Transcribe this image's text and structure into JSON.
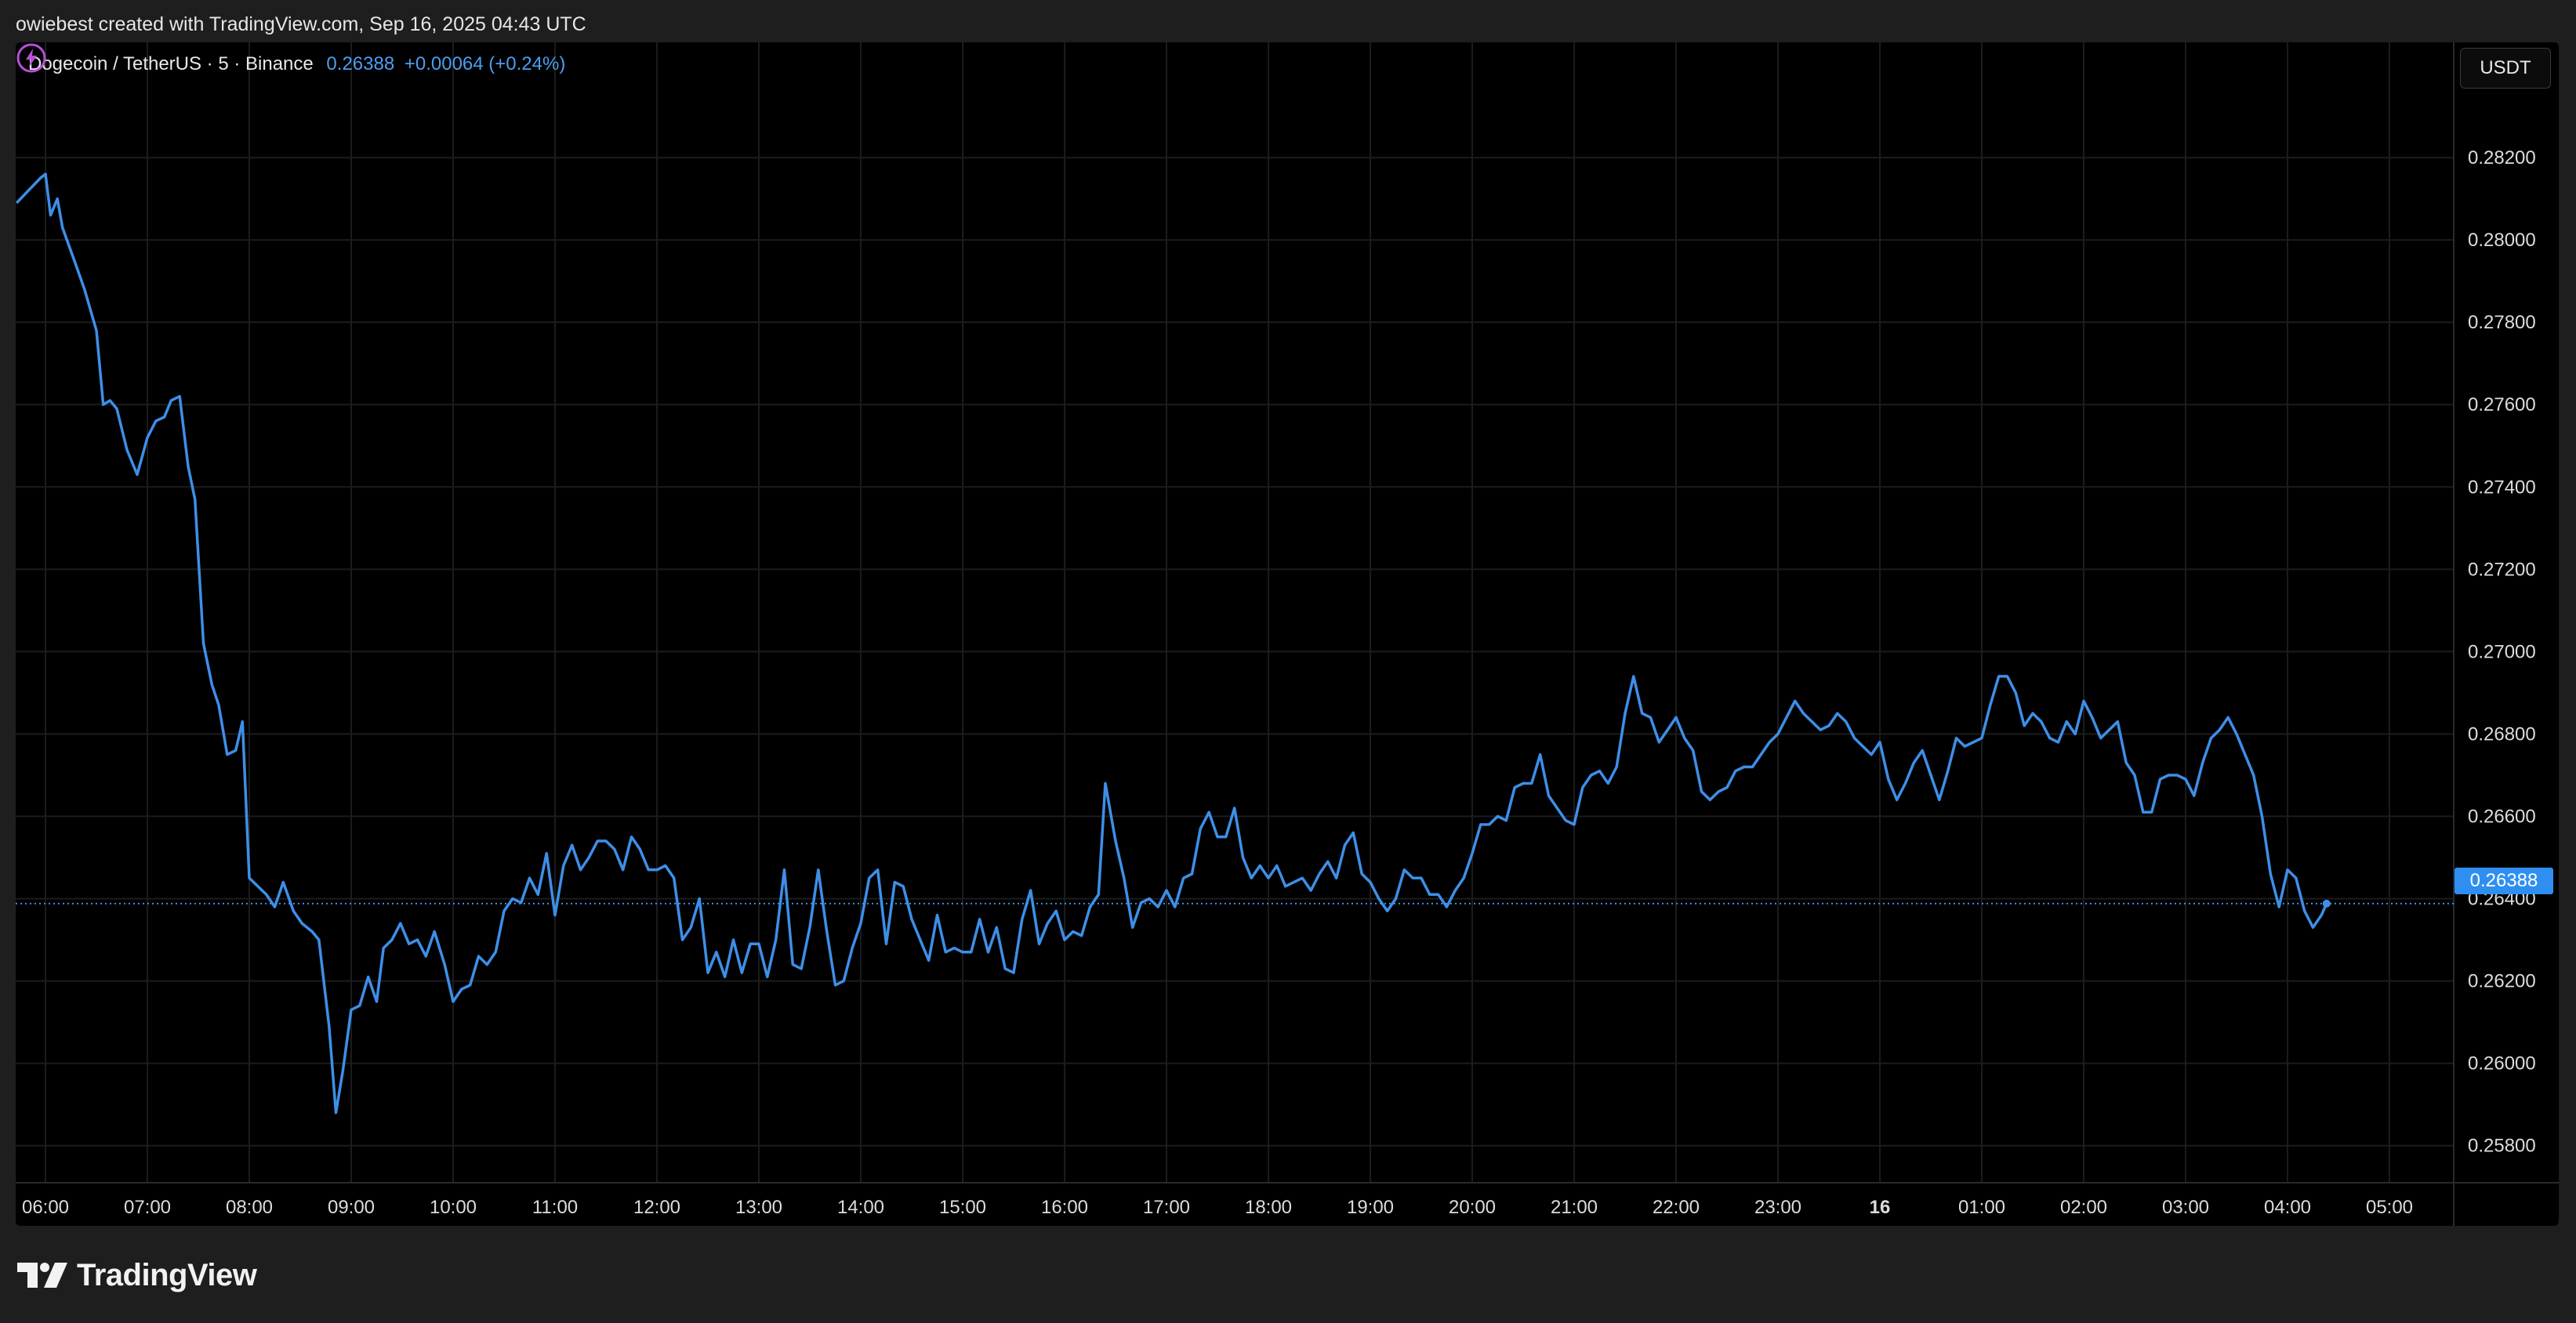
{
  "header": {
    "attribution": "owiebest created with TradingView.com, Sep 16, 2025 04:43 UTC"
  },
  "legend": {
    "symbol": "Dogecoin / TetherUS · 5 · Binance",
    "price": "0.26388",
    "change": "+0.00064 (+0.24%)"
  },
  "currency_unit": "USDT",
  "current_price_label": "0.26388",
  "footer": {
    "brand": "TradingView"
  },
  "colors": {
    "line": "#3d8fe8",
    "background": "#000000",
    "price_label": "#2f8ff0",
    "grid": "#1c1c1c",
    "bolt": "#b84fd8"
  },
  "icons": {
    "logo": "tradingview-logo-icon",
    "realtime": "lightning-bolt-icon"
  },
  "chart_data": {
    "type": "line",
    "title": "",
    "xlabel": "",
    "ylabel": "",
    "ylim": [
      0.2571,
      0.2848
    ],
    "grid": true,
    "x_ticks": [
      "06:00",
      "07:00",
      "08:00",
      "09:00",
      "10:00",
      "11:00",
      "12:00",
      "13:00",
      "14:00",
      "15:00",
      "16:00",
      "17:00",
      "18:00",
      "19:00",
      "20:00",
      "21:00",
      "22:00",
      "23:00",
      "16",
      "01:00",
      "02:00",
      "03:00",
      "04:00",
      "05:00"
    ],
    "x_tick_bold": "16",
    "y_ticks": [
      "0.28200",
      "0.28000",
      "0.27800",
      "0.27600",
      "0.27400",
      "0.27200",
      "0.27000",
      "0.26800",
      "0.26600",
      "0.26400",
      "0.26200",
      "0.26000",
      "0.25800"
    ],
    "last_price": 0.26388,
    "series": [
      {
        "points": [
          [
            "05:43",
            0.2809
          ],
          [
            "05:50",
            0.2812
          ],
          [
            "05:57",
            0.2815
          ],
          [
            "06:00",
            0.2816
          ],
          [
            "06:03",
            0.2806
          ],
          [
            "06:07",
            0.281
          ],
          [
            "06:10",
            0.2803
          ],
          [
            "06:17",
            0.2795
          ],
          [
            "06:23",
            0.2788
          ],
          [
            "06:30",
            0.2778
          ],
          [
            "06:34",
            0.276
          ],
          [
            "06:38",
            0.2761
          ],
          [
            "06:42",
            0.2759
          ],
          [
            "06:48",
            0.2749
          ],
          [
            "06:54",
            0.2743
          ],
          [
            "07:00",
            0.2752
          ],
          [
            "07:05",
            0.2756
          ],
          [
            "07:10",
            0.2757
          ],
          [
            "07:14",
            0.2761
          ],
          [
            "07:19",
            0.2762
          ],
          [
            "07:24",
            0.2745
          ],
          [
            "07:28",
            0.2737
          ],
          [
            "07:33",
            0.2702
          ],
          [
            "07:38",
            0.2692
          ],
          [
            "07:42",
            0.2687
          ],
          [
            "07:47",
            0.2675
          ],
          [
            "07:52",
            0.2676
          ],
          [
            "07:56",
            0.2683
          ],
          [
            "08:00",
            0.2645
          ],
          [
            "08:05",
            0.2643
          ],
          [
            "08:10",
            0.2641
          ],
          [
            "08:15",
            0.2638
          ],
          [
            "08:20",
            0.2644
          ],
          [
            "08:26",
            0.2637
          ],
          [
            "08:31",
            0.2634
          ],
          [
            "08:37",
            0.2632
          ],
          [
            "08:41",
            0.263
          ],
          [
            "08:47",
            0.2609
          ],
          [
            "08:51",
            0.2588
          ],
          [
            "08:55",
            0.2598
          ],
          [
            "09:00",
            0.2613
          ],
          [
            "09:05",
            0.2614
          ],
          [
            "09:10",
            0.2621
          ],
          [
            "09:15",
            0.2615
          ],
          [
            "09:19",
            0.2628
          ],
          [
            "09:24",
            0.263
          ],
          [
            "09:29",
            0.2634
          ],
          [
            "09:34",
            0.2629
          ],
          [
            "09:39",
            0.263
          ],
          [
            "09:44",
            0.2626
          ],
          [
            "09:49",
            0.2632
          ],
          [
            "09:55",
            0.2624
          ],
          [
            "10:00",
            0.2615
          ],
          [
            "10:05",
            0.2618
          ],
          [
            "10:10",
            0.2619
          ],
          [
            "10:15",
            0.2626
          ],
          [
            "10:20",
            0.2624
          ],
          [
            "10:25",
            0.2627
          ],
          [
            "10:30",
            0.2637
          ],
          [
            "10:35",
            0.264
          ],
          [
            "10:40",
            0.2639
          ],
          [
            "10:45",
            0.2645
          ],
          [
            "10:50",
            0.2641
          ],
          [
            "10:55",
            0.2651
          ],
          [
            "11:00",
            0.2636
          ],
          [
            "11:05",
            0.2648
          ],
          [
            "11:10",
            0.2653
          ],
          [
            "11:15",
            0.2647
          ],
          [
            "11:20",
            0.265
          ],
          [
            "11:25",
            0.2654
          ],
          [
            "11:30",
            0.2654
          ],
          [
            "11:35",
            0.2652
          ],
          [
            "11:40",
            0.2647
          ],
          [
            "11:45",
            0.2655
          ],
          [
            "11:50",
            0.2652
          ],
          [
            "11:55",
            0.2647
          ],
          [
            "12:00",
            0.2647
          ],
          [
            "12:05",
            0.2648
          ],
          [
            "12:10",
            0.2645
          ],
          [
            "12:15",
            0.263
          ],
          [
            "12:20",
            0.2633
          ],
          [
            "12:25",
            0.264
          ],
          [
            "12:30",
            0.2622
          ],
          [
            "12:35",
            0.2627
          ],
          [
            "12:40",
            0.2621
          ],
          [
            "12:45",
            0.263
          ],
          [
            "12:50",
            0.2622
          ],
          [
            "12:55",
            0.2629
          ],
          [
            "13:00",
            0.2629
          ],
          [
            "13:05",
            0.2621
          ],
          [
            "13:10",
            0.263
          ],
          [
            "13:15",
            0.2647
          ],
          [
            "13:20",
            0.2624
          ],
          [
            "13:25",
            0.2623
          ],
          [
            "13:30",
            0.2633
          ],
          [
            "13:35",
            0.2647
          ],
          [
            "13:40",
            0.2632
          ],
          [
            "13:45",
            0.2619
          ],
          [
            "13:50",
            0.262
          ],
          [
            "13:55",
            0.2628
          ],
          [
            "14:00",
            0.2634
          ],
          [
            "14:05",
            0.2645
          ],
          [
            "14:10",
            0.2647
          ],
          [
            "14:15",
            0.2629
          ],
          [
            "14:20",
            0.2644
          ],
          [
            "14:25",
            0.2643
          ],
          [
            "14:30",
            0.2635
          ],
          [
            "14:35",
            0.263
          ],
          [
            "14:40",
            0.2625
          ],
          [
            "14:45",
            0.2636
          ],
          [
            "14:50",
            0.2627
          ],
          [
            "14:55",
            0.2628
          ],
          [
            "15:00",
            0.2627
          ],
          [
            "15:05",
            0.2627
          ],
          [
            "15:10",
            0.2635
          ],
          [
            "15:15",
            0.2627
          ],
          [
            "15:20",
            0.2633
          ],
          [
            "15:25",
            0.2623
          ],
          [
            "15:30",
            0.2622
          ],
          [
            "15:35",
            0.2635
          ],
          [
            "15:40",
            0.2642
          ],
          [
            "15:45",
            0.2629
          ],
          [
            "15:50",
            0.2634
          ],
          [
            "15:55",
            0.2637
          ],
          [
            "16:00",
            0.263
          ],
          [
            "16:05",
            0.2632
          ],
          [
            "16:10",
            0.2631
          ],
          [
            "16:15",
            0.2638
          ],
          [
            "16:20",
            0.2641
          ],
          [
            "16:24",
            0.2668
          ],
          [
            "16:30",
            0.2654
          ],
          [
            "16:35",
            0.2645
          ],
          [
            "16:40",
            0.2633
          ],
          [
            "16:45",
            0.2639
          ],
          [
            "16:50",
            0.264
          ],
          [
            "16:55",
            0.2638
          ],
          [
            "17:00",
            0.2642
          ],
          [
            "17:05",
            0.2638
          ],
          [
            "17:10",
            0.2645
          ],
          [
            "17:15",
            0.2646
          ],
          [
            "17:20",
            0.2657
          ],
          [
            "17:25",
            0.2661
          ],
          [
            "17:30",
            0.2655
          ],
          [
            "17:35",
            0.2655
          ],
          [
            "17:40",
            0.2662
          ],
          [
            "17:45",
            0.265
          ],
          [
            "17:50",
            0.2645
          ],
          [
            "17:55",
            0.2648
          ],
          [
            "18:00",
            0.2645
          ],
          [
            "18:05",
            0.2648
          ],
          [
            "18:10",
            0.2643
          ],
          [
            "18:15",
            0.2644
          ],
          [
            "18:20",
            0.2645
          ],
          [
            "18:25",
            0.2642
          ],
          [
            "18:30",
            0.2646
          ],
          [
            "18:35",
            0.2649
          ],
          [
            "18:40",
            0.2645
          ],
          [
            "18:45",
            0.2653
          ],
          [
            "18:50",
            0.2656
          ],
          [
            "18:55",
            0.2646
          ],
          [
            "19:00",
            0.2644
          ],
          [
            "19:05",
            0.264
          ],
          [
            "19:10",
            0.2637
          ],
          [
            "19:15",
            0.264
          ],
          [
            "19:20",
            0.2647
          ],
          [
            "19:25",
            0.2645
          ],
          [
            "19:30",
            0.2645
          ],
          [
            "19:35",
            0.2641
          ],
          [
            "19:40",
            0.2641
          ],
          [
            "19:45",
            0.2638
          ],
          [
            "19:50",
            0.2642
          ],
          [
            "19:55",
            0.2645
          ],
          [
            "20:00",
            0.2651
          ],
          [
            "20:05",
            0.2658
          ],
          [
            "20:10",
            0.2658
          ],
          [
            "20:15",
            0.266
          ],
          [
            "20:20",
            0.2659
          ],
          [
            "20:25",
            0.2667
          ],
          [
            "20:30",
            0.2668
          ],
          [
            "20:35",
            0.2668
          ],
          [
            "20:40",
            0.2675
          ],
          [
            "20:45",
            0.2665
          ],
          [
            "20:50",
            0.2662
          ],
          [
            "20:55",
            0.2659
          ],
          [
            "21:00",
            0.2658
          ],
          [
            "21:05",
            0.2667
          ],
          [
            "21:10",
            0.267
          ],
          [
            "21:15",
            0.2671
          ],
          [
            "21:20",
            0.2668
          ],
          [
            "21:25",
            0.2672
          ],
          [
            "21:30",
            0.2685
          ],
          [
            "21:35",
            0.2694
          ],
          [
            "21:40",
            0.2685
          ],
          [
            "21:45",
            0.2684
          ],
          [
            "21:50",
            0.2678
          ],
          [
            "21:55",
            0.2681
          ],
          [
            "22:00",
            0.2684
          ],
          [
            "22:05",
            0.2679
          ],
          [
            "22:10",
            0.2676
          ],
          [
            "22:15",
            0.2666
          ],
          [
            "22:20",
            0.2664
          ],
          [
            "22:25",
            0.2666
          ],
          [
            "22:30",
            0.2667
          ],
          [
            "22:35",
            0.2671
          ],
          [
            "22:40",
            0.2672
          ],
          [
            "22:45",
            0.2672
          ],
          [
            "22:50",
            0.2675
          ],
          [
            "22:55",
            0.2678
          ],
          [
            "23:00",
            0.268
          ],
          [
            "23:05",
            0.2684
          ],
          [
            "23:10",
            0.2688
          ],
          [
            "23:15",
            0.2685
          ],
          [
            "23:20",
            0.2683
          ],
          [
            "23:25",
            0.2681
          ],
          [
            "23:30",
            0.2682
          ],
          [
            "23:35",
            0.2685
          ],
          [
            "23:40",
            0.2683
          ],
          [
            "23:45",
            0.2679
          ],
          [
            "23:50",
            0.2677
          ],
          [
            "23:55",
            0.2675
          ],
          [
            "00:00",
            0.2678
          ],
          [
            "00:05",
            0.2669
          ],
          [
            "00:10",
            0.2664
          ],
          [
            "00:15",
            0.2668
          ],
          [
            "00:20",
            0.2673
          ],
          [
            "00:25",
            0.2676
          ],
          [
            "00:30",
            0.267
          ],
          [
            "00:35",
            0.2664
          ],
          [
            "00:40",
            0.2671
          ],
          [
            "00:45",
            0.2679
          ],
          [
            "00:50",
            0.2677
          ],
          [
            "00:55",
            0.2678
          ],
          [
            "01:00",
            0.2679
          ],
          [
            "01:05",
            0.2687
          ],
          [
            "01:10",
            0.2694
          ],
          [
            "01:15",
            0.2694
          ],
          [
            "01:20",
            0.269
          ],
          [
            "01:25",
            0.2682
          ],
          [
            "01:30",
            0.2685
          ],
          [
            "01:35",
            0.2683
          ],
          [
            "01:40",
            0.2679
          ],
          [
            "01:45",
            0.2678
          ],
          [
            "01:50",
            0.2683
          ],
          [
            "01:55",
            0.268
          ],
          [
            "02:00",
            0.2688
          ],
          [
            "02:05",
            0.2684
          ],
          [
            "02:10",
            0.2679
          ],
          [
            "02:15",
            0.2681
          ],
          [
            "02:20",
            0.2683
          ],
          [
            "02:25",
            0.2673
          ],
          [
            "02:30",
            0.267
          ],
          [
            "02:35",
            0.2661
          ],
          [
            "02:40",
            0.2661
          ],
          [
            "02:45",
            0.2669
          ],
          [
            "02:50",
            0.267
          ],
          [
            "02:55",
            0.267
          ],
          [
            "03:00",
            0.2669
          ],
          [
            "03:05",
            0.2665
          ],
          [
            "03:10",
            0.2673
          ],
          [
            "03:15",
            0.2679
          ],
          [
            "03:20",
            0.2681
          ],
          [
            "03:25",
            0.2684
          ],
          [
            "03:30",
            0.268
          ],
          [
            "03:35",
            0.2675
          ],
          [
            "03:40",
            0.267
          ],
          [
            "03:45",
            0.266
          ],
          [
            "03:50",
            0.2646
          ],
          [
            "03:55",
            0.2638
          ],
          [
            "04:00",
            0.2647
          ],
          [
            "04:05",
            0.2645
          ],
          [
            "04:10",
            0.2637
          ],
          [
            "04:15",
            0.2633
          ],
          [
            "04:20",
            0.2636
          ],
          [
            "04:23",
            0.26388
          ]
        ]
      }
    ]
  }
}
